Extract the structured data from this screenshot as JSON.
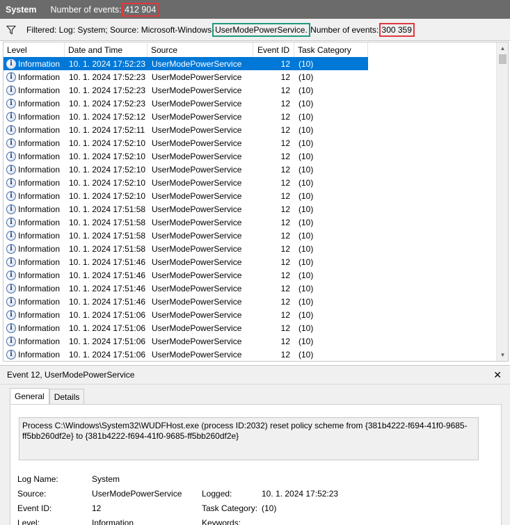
{
  "header": {
    "log_name": "System",
    "count_label": "Number of events: ",
    "count_value": "412 904"
  },
  "filter": {
    "prefix": "Filtered: Log: System; Source: Microsoft-Windows-",
    "source_highlight": "UserModePowerService.",
    "count_label": " Number of events: ",
    "count_value": "300 359"
  },
  "columns": [
    "Level",
    "Date and Time",
    "Source",
    "Event ID",
    "Task Category"
  ],
  "events": [
    {
      "level": "Information",
      "datetime": "10. 1. 2024 17:52:23",
      "source": "UserModePowerService",
      "event_id": "12",
      "task": "(10)"
    },
    {
      "level": "Information",
      "datetime": "10. 1. 2024 17:52:23",
      "source": "UserModePowerService",
      "event_id": "12",
      "task": "(10)"
    },
    {
      "level": "Information",
      "datetime": "10. 1. 2024 17:52:23",
      "source": "UserModePowerService",
      "event_id": "12",
      "task": "(10)"
    },
    {
      "level": "Information",
      "datetime": "10. 1. 2024 17:52:23",
      "source": "UserModePowerService",
      "event_id": "12",
      "task": "(10)"
    },
    {
      "level": "Information",
      "datetime": "10. 1. 2024 17:52:12",
      "source": "UserModePowerService",
      "event_id": "12",
      "task": "(10)"
    },
    {
      "level": "Information",
      "datetime": "10. 1. 2024 17:52:11",
      "source": "UserModePowerService",
      "event_id": "12",
      "task": "(10)"
    },
    {
      "level": "Information",
      "datetime": "10. 1. 2024 17:52:10",
      "source": "UserModePowerService",
      "event_id": "12",
      "task": "(10)"
    },
    {
      "level": "Information",
      "datetime": "10. 1. 2024 17:52:10",
      "source": "UserModePowerService",
      "event_id": "12",
      "task": "(10)"
    },
    {
      "level": "Information",
      "datetime": "10. 1. 2024 17:52:10",
      "source": "UserModePowerService",
      "event_id": "12",
      "task": "(10)"
    },
    {
      "level": "Information",
      "datetime": "10. 1. 2024 17:52:10",
      "source": "UserModePowerService",
      "event_id": "12",
      "task": "(10)"
    },
    {
      "level": "Information",
      "datetime": "10. 1. 2024 17:52:10",
      "source": "UserModePowerService",
      "event_id": "12",
      "task": "(10)"
    },
    {
      "level": "Information",
      "datetime": "10. 1. 2024 17:51:58",
      "source": "UserModePowerService",
      "event_id": "12",
      "task": "(10)"
    },
    {
      "level": "Information",
      "datetime": "10. 1. 2024 17:51:58",
      "source": "UserModePowerService",
      "event_id": "12",
      "task": "(10)"
    },
    {
      "level": "Information",
      "datetime": "10. 1. 2024 17:51:58",
      "source": "UserModePowerService",
      "event_id": "12",
      "task": "(10)"
    },
    {
      "level": "Information",
      "datetime": "10. 1. 2024 17:51:58",
      "source": "UserModePowerService",
      "event_id": "12",
      "task": "(10)"
    },
    {
      "level": "Information",
      "datetime": "10. 1. 2024 17:51:46",
      "source": "UserModePowerService",
      "event_id": "12",
      "task": "(10)"
    },
    {
      "level": "Information",
      "datetime": "10. 1. 2024 17:51:46",
      "source": "UserModePowerService",
      "event_id": "12",
      "task": "(10)"
    },
    {
      "level": "Information",
      "datetime": "10. 1. 2024 17:51:46",
      "source": "UserModePowerService",
      "event_id": "12",
      "task": "(10)"
    },
    {
      "level": "Information",
      "datetime": "10. 1. 2024 17:51:46",
      "source": "UserModePowerService",
      "event_id": "12",
      "task": "(10)"
    },
    {
      "level": "Information",
      "datetime": "10. 1. 2024 17:51:06",
      "source": "UserModePowerService",
      "event_id": "12",
      "task": "(10)"
    },
    {
      "level": "Information",
      "datetime": "10. 1. 2024 17:51:06",
      "source": "UserModePowerService",
      "event_id": "12",
      "task": "(10)"
    },
    {
      "level": "Information",
      "datetime": "10. 1. 2024 17:51:06",
      "source": "UserModePowerService",
      "event_id": "12",
      "task": "(10)"
    },
    {
      "level": "Information",
      "datetime": "10. 1. 2024 17:51:06",
      "source": "UserModePowerService",
      "event_id": "12",
      "task": "(10)"
    }
  ],
  "detail": {
    "title": "Event 12, UserModePowerService",
    "close_glyph": "✕",
    "tabs": [
      "General",
      "Details"
    ],
    "description": "Process C:\\Windows\\System32\\WUDFHost.exe (process ID:2032) reset policy scheme from {381b4222-f694-41f0-9685-ff5bb260df2e} to {381b4222-f694-41f0-9685-ff5bb260df2e}",
    "log_name_label": "Log Name:",
    "log_name_value": "System",
    "source_label": "Source:",
    "source_value": "UserModePowerService",
    "logged_label": "Logged:",
    "logged_value": "10. 1. 2024 17:52:23",
    "event_id_label": "Event ID:",
    "event_id_value": "12",
    "task_label": "Task Category:",
    "task_value": "(10)",
    "level_label": "Level:",
    "level_value": "Information",
    "keywords_label": "Keywords:"
  },
  "icons": {
    "filter": "funnel-icon",
    "level": "information-icon",
    "close": "close-icon"
  },
  "colors": {
    "title_bg": "#6b6b6b",
    "selection": "#0078d7",
    "highlight_red": "#e0383e",
    "highlight_green": "#1e9a80"
  }
}
